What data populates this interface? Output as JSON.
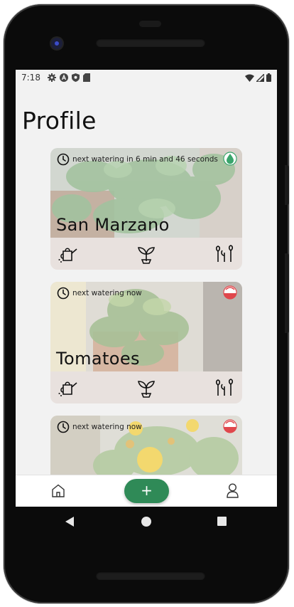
{
  "status_bar": {
    "time": "7:18"
  },
  "page": {
    "title": "Profile"
  },
  "plants": [
    {
      "name": "San Marzano",
      "watering_text": "next watering in 6 min and 46 seconds",
      "water_status": "ok",
      "water_color": "#3aa56c"
    },
    {
      "name": "Tomatoes",
      "watering_text": "next watering now",
      "water_status": "due",
      "water_color": "#e0474c"
    },
    {
      "name": "",
      "watering_text": "next watering now",
      "water_status": "due",
      "water_color": "#e0474c"
    }
  ],
  "card_tools": [
    "watering-can-icon",
    "sprout-icon",
    "growth-icon"
  ],
  "bottom_nav": {
    "add_label": "+"
  },
  "colors": {
    "accent": "#2f8a57",
    "tool_bar_bg": "#e8e1de",
    "screen_bg": "#f2f2f2"
  }
}
